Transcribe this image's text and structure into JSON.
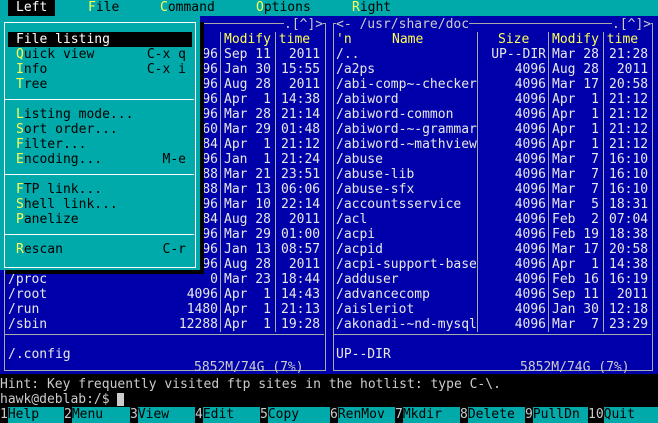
{
  "menubar": {
    "items": [
      {
        "label": "Left",
        "hot": "",
        "rest": "Left"
      },
      {
        "label": "File",
        "hot": "F",
        "rest": "ile"
      },
      {
        "label": "Command",
        "hot": "C",
        "rest": "ommand"
      },
      {
        "label": "Options",
        "hot": "O",
        "rest": "ptions"
      },
      {
        "label": "Right",
        "hot": "R",
        "rest": "ight"
      }
    ]
  },
  "dropdown": {
    "items": [
      {
        "hot": "F",
        "rest": "ile listing",
        "key": ""
      },
      {
        "hot": "Q",
        "rest": "uick view",
        "key": "C-x q"
      },
      {
        "hot": "I",
        "rest": "nfo",
        "key": "C-x i"
      },
      {
        "hot": "T",
        "rest": "ree",
        "key": ""
      },
      {
        "hot": "L",
        "rest": "isting mode...",
        "key": ""
      },
      {
        "hot": "S",
        "rest": "ort order...",
        "key": ""
      },
      {
        "hot": "F",
        "rest": "ilter...",
        "key": ""
      },
      {
        "hot": "E",
        "rest": "ncoding...",
        "key": "M-e"
      },
      {
        "hot": "F",
        "rest": "TP link...",
        "key": ""
      },
      {
        "hot": "S",
        "rest": "hell link...",
        "key": ""
      },
      {
        "hot": "P",
        "rest": "anelize",
        "key": ""
      },
      {
        "hot": "R",
        "rest": "escan",
        "key": "C-r"
      }
    ]
  },
  "left_panel": {
    "title_tail": ".[^]>",
    "col_modify": "Modify time",
    "rows": [
      {
        "name": "",
        "size": "96",
        "date": "Sep 11",
        "time": " 2011"
      },
      {
        "name": "",
        "size": "96",
        "date": "Jan 30",
        "time": "15:55"
      },
      {
        "name": "",
        "size": "96",
        "date": "Aug 28",
        "time": " 2011"
      },
      {
        "name": "",
        "size": "96",
        "date": "Apr  1",
        "time": "14:38"
      },
      {
        "name": "",
        "size": "96",
        "date": "Mar 28",
        "time": "21:14"
      },
      {
        "name": "",
        "size": "60",
        "date": "Mar 29",
        "time": "01:48"
      },
      {
        "name": "",
        "size": "84",
        "date": "Apr  1",
        "time": "21:12"
      },
      {
        "name": "",
        "size": "96",
        "date": "Jan  1",
        "time": "21:24"
      },
      {
        "name": "",
        "size": "88",
        "date": "Mar 21",
        "time": "23:51"
      },
      {
        "name": "",
        "size": "88",
        "date": "Mar 13",
        "time": "06:06"
      },
      {
        "name": "",
        "size": "96",
        "date": "Mar 10",
        "time": "22:14"
      },
      {
        "name": "",
        "size": "84",
        "date": "Aug 28",
        "time": " 2011"
      },
      {
        "name": "",
        "size": "96",
        "date": "Mar 29",
        "time": "01:00"
      },
      {
        "name": "",
        "size": "96",
        "date": "Jan 13",
        "time": "08:57"
      },
      {
        "name": "",
        "size": "96",
        "date": "Aug 28",
        "time": " 2011"
      },
      {
        "name": "/proc",
        "size": "0",
        "date": "Mar 23",
        "time": "18:44"
      },
      {
        "name": "/root",
        "size": "4096",
        "date": "Apr  1",
        "time": "14:43"
      },
      {
        "name": "/run",
        "size": "1480",
        "date": "Apr  1",
        "time": "21:13"
      },
      {
        "name": "/sbin",
        "size": "12288",
        "date": "Apr  1",
        "time": "19:28"
      }
    ],
    "status": "/.config",
    "footer": "5852M/74G (7%)"
  },
  "right_panel": {
    "title": "<- /usr/share/doc",
    "title_tail": ".[^]>",
    "col_n": "'n",
    "col_name": "Name",
    "col_size": "Size",
    "col_modify": "Modify time",
    "rows": [
      {
        "name": "/..",
        "size": "UP--DIR",
        "date": "Mar 28",
        "time": "21:28"
      },
      {
        "name": "/a2ps",
        "size": "4096",
        "date": "Aug 28",
        "time": " 2011"
      },
      {
        "name": "/abi-comp~-checker",
        "size": "4096",
        "date": "Mar 17",
        "time": "20:58"
      },
      {
        "name": "/abiword",
        "size": "4096",
        "date": "Apr  1",
        "time": "21:12"
      },
      {
        "name": "/abiword-common",
        "size": "4096",
        "date": "Apr  1",
        "time": "21:12"
      },
      {
        "name": "/abiword-~-grammar",
        "size": "4096",
        "date": "Apr  1",
        "time": "21:12"
      },
      {
        "name": "/abiword-~mathview",
        "size": "4096",
        "date": "Apr  1",
        "time": "21:12"
      },
      {
        "name": "/abuse",
        "size": "4096",
        "date": "Mar  7",
        "time": "16:10"
      },
      {
        "name": "/abuse-lib",
        "size": "4096",
        "date": "Mar  7",
        "time": "16:10"
      },
      {
        "name": "/abuse-sfx",
        "size": "4096",
        "date": "Mar  7",
        "time": "16:10"
      },
      {
        "name": "/accountsservice",
        "size": "4096",
        "date": "Mar  5",
        "time": "18:31"
      },
      {
        "name": "/acl",
        "size": "4096",
        "date": "Feb  2",
        "time": "07:04"
      },
      {
        "name": "/acpi",
        "size": "4096",
        "date": "Feb 19",
        "time": "18:38"
      },
      {
        "name": "/acpid",
        "size": "4096",
        "date": "Mar 17",
        "time": "20:58"
      },
      {
        "name": "/acpi-support-base",
        "size": "4096",
        "date": "Apr  1",
        "time": "14:38"
      },
      {
        "name": "/adduser",
        "size": "4096",
        "date": "Feb 16",
        "time": "16:19"
      },
      {
        "name": "/advancecomp",
        "size": "4096",
        "date": "Sep 11",
        "time": " 2011"
      },
      {
        "name": "/aisleriot",
        "size": "4096",
        "date": "Jan 30",
        "time": "12:18"
      },
      {
        "name": "/akonadi-~nd-mysql",
        "size": "4096",
        "date": "Mar  7",
        "time": "23:29"
      }
    ],
    "status": "UP--DIR",
    "footer": "5852M/74G (7%)"
  },
  "hint": "Hint: Key frequently visited ftp sites in the hotlist: type C-\\.",
  "cmdline": "hawk@deblab:/$ ",
  "fkeys": [
    {
      "num": "1",
      "label": "Help"
    },
    {
      "num": "2",
      "label": "Menu"
    },
    {
      "num": "3",
      "label": "View"
    },
    {
      "num": "4",
      "label": "Edit"
    },
    {
      "num": "5",
      "label": "Copy"
    },
    {
      "num": "6",
      "label": "RenMov"
    },
    {
      "num": "7",
      "label": "Mkdir"
    },
    {
      "num": "8",
      "label": "Delete"
    },
    {
      "num": "9",
      "label": "PullDn"
    },
    {
      "num": "10",
      "label": "Quit"
    }
  ]
}
